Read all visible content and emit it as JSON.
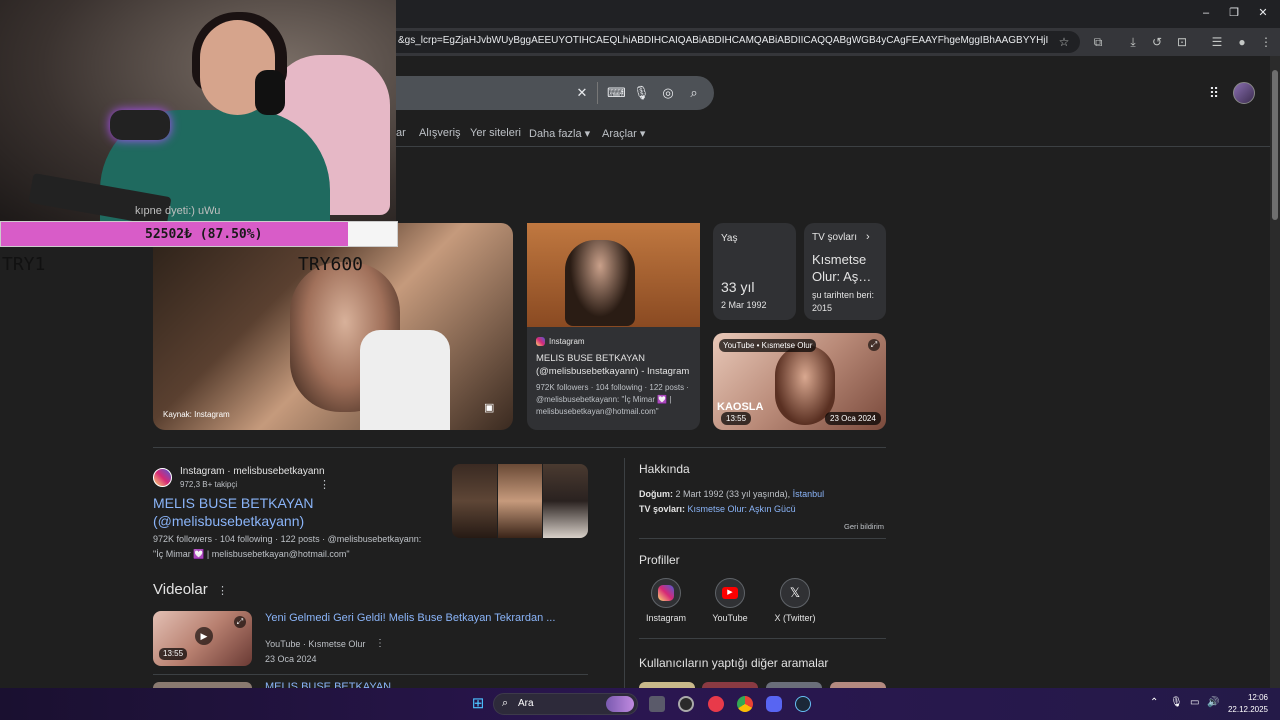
{
  "browser": {
    "url": "&gs_lcrp=EgZjaHJvbWUyBggAEEUYOTIHCAEQLhiABDIHCAIQABiABDIHCAMQABiABDIICAQQABgWGB4yCAgFEAAYFhgeMggIBhAAGBYYHjIICAcQABgWGB4y...",
    "minimize_label": "–",
    "maximize_label": "❐",
    "close_label": "✕"
  },
  "search": {
    "tabs": [
      "ar",
      "Alışveriş",
      "Yer siteleri",
      "Daha fazla ▾",
      "Araçlar ▾"
    ]
  },
  "webcam_overlay": {
    "chat_line": "kıpne dyeti:) uWu",
    "donation": "52502₺ (87.50%)",
    "donation_progress": 0.875,
    "left_label": "TRY1",
    "right_label": "TRY600"
  },
  "images": {
    "main_caption": "Kaynak: Instagram",
    "ig_card": {
      "source": "Instagram",
      "title": "MELIS BUSE BETKAYAN (@melisbusebetkayann) - Instagram",
      "desc": "972K followers · 104 following · 122 posts · @melisbusebetkayann: \"İç Mimar 💟 | melisbusebetkayan@hotmail.com\""
    },
    "age_card": {
      "label": "Yaş",
      "value": "33 yıl",
      "date": "2 Mar 1992"
    },
    "tv_card": {
      "label": "TV şovları",
      "title": "Kısmetse Olur: Aş…",
      "since": "şu tarihten beri: 2015"
    },
    "yt_card": {
      "source": "YouTube • Kısmetse Olur",
      "duration": "13:55",
      "date": "23 Oca 2024",
      "overlay": "KAOSLA"
    }
  },
  "result": {
    "source": "Instagram · melisbusebetkayann",
    "followers": "972,3 B+ takipçi",
    "title_line1": "MELIS BUSE BETKAYAN",
    "title_line2": "(@melisbusebetkayann)",
    "snippet_line1": "972K followers · 104 following · 122 posts · @melisbusebetkayann:",
    "snippet_line2": "\"İç Mimar 💟 | melisbusebetkayan@hotmail.com\""
  },
  "videos": {
    "heading": "Videolar",
    "items": [
      {
        "title": "Yeni Gelmedi Geri Geldi! Melis Buse Betkayan Tekrardan ...",
        "meta": "YouTube · Kısmetse Olur",
        "date": "23 Oca 2024",
        "duration": "13:55"
      },
      {
        "title": "MELIS BUSE BETKAYAN ..."
      }
    ]
  },
  "panel": {
    "heading": "Hakkında",
    "born_label": "Doğum:",
    "born_value": "2 Mart 1992 (33 yıl yaşında),",
    "born_place": "İstanbul",
    "tv_label": "TV şovları:",
    "tv_value": "Kısmetse Olur: Aşkın Gücü",
    "feedback": "Geri bildirim",
    "profiles_heading": "Profiller",
    "profiles": [
      "Instagram",
      "YouTube",
      "X (Twitter)"
    ],
    "related_heading": "Kullanıcıların yaptığı diğer aramalar"
  },
  "taskbar": {
    "search_placeholder": "Ara",
    "time": "12:06",
    "date": "22.12.2025"
  }
}
